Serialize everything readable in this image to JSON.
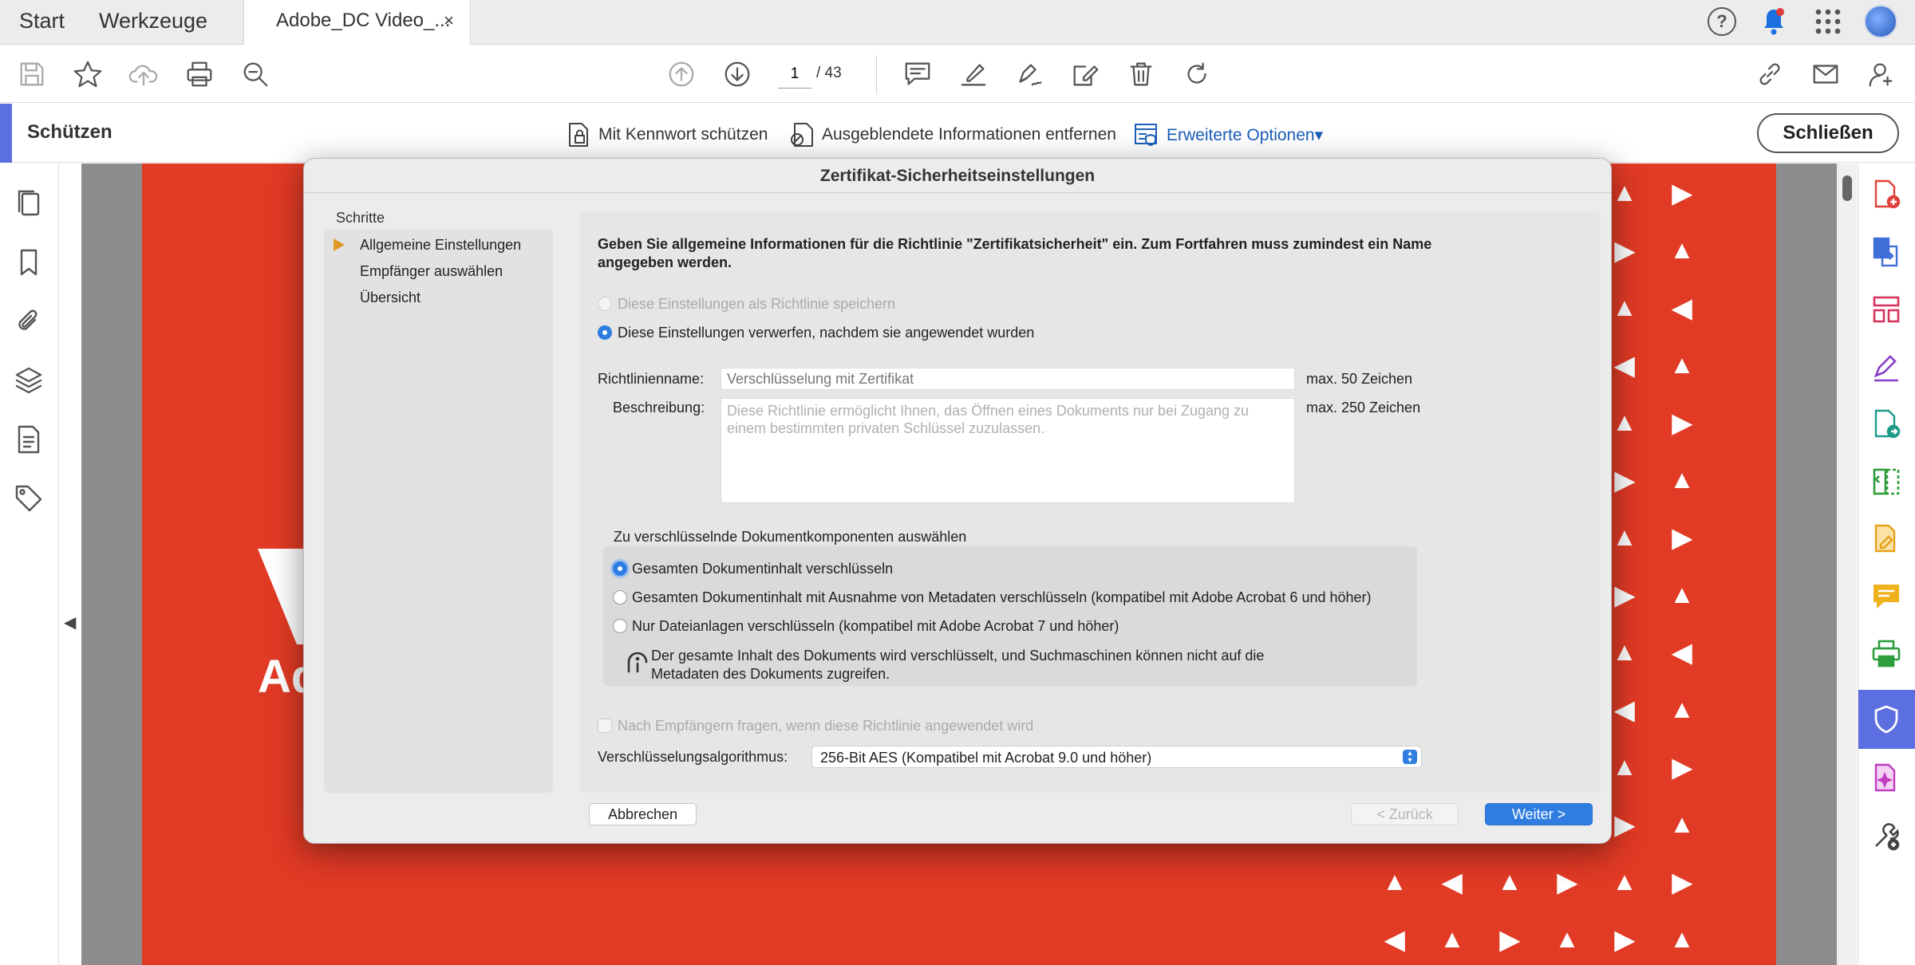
{
  "tabs": {
    "start": "Start",
    "tools": "Werkzeuge",
    "document": "Adobe_DC Video_...",
    "close_glyph": "×"
  },
  "toolbar": {
    "current_page": "1",
    "total_pages": "/ 43"
  },
  "protect_bar": {
    "title": "Schützen",
    "password_protect": "Mit Kennwort schützen",
    "remove_hidden": "Ausgeblendete Informationen entfernen",
    "advanced_options": "Erweiterte Optionen▾",
    "close_button": "Schließen"
  },
  "dialog": {
    "title": "Zertifikat-Sicherheitseinstellungen",
    "steps_heading": "Schritte",
    "steps": [
      "Allgemeine Einstellungen",
      "Empfänger auswählen",
      "Übersicht"
    ],
    "intro": "Geben Sie allgemeine Informationen für die Richtlinie \"Zertifikatsicherheit\" ein. Zum Fortfahren muss zumindest ein Name angegeben werden.",
    "save_as_policy": "Diese Einstellungen als Richtlinie speichern",
    "discard_after_apply": "Diese Einstellungen verwerfen, nachdem sie angewendet wurden",
    "policy_name_label": "Richtlinienname:",
    "policy_name_placeholder": "Verschlüsselung mit Zertifikat",
    "policy_name_limit": "max. 50 Zeichen",
    "description_label": "Beschreibung:",
    "description_placeholder": "Diese Richtlinie ermöglicht Ihnen, das Öffnen eines Dokuments nur bei Zugang zu einem bestimmten privaten Schlüssel zuzulassen.",
    "description_limit": "max. 250 Zeichen",
    "components_heading": "Zu verschlüsselnde Dokumentkomponenten auswählen",
    "components": [
      "Gesamten Dokumentinhalt verschlüsseln",
      "Gesamten Dokumentinhalt mit Ausnahme von Metadaten verschlüsseln (kompatibel mit Adobe Acrobat 6 und höher)",
      "Nur Dateianlagen verschlüsseln (kompatibel mit Adobe Acrobat 7 und höher)"
    ],
    "components_info": "Der gesamte Inhalt des Dokuments wird verschlüsselt, und Suchmaschinen können nicht auf die Metadaten des Dokuments zugreifen.",
    "ask_recipients": "Nach Empfängern fragen, wenn diese Richtlinie angewendet wird",
    "algorithm_label": "Verschlüsselungsalgorithmus:",
    "algorithm_value": "256-Bit AES (Kompatibel mit Acrobat 9.0 und höher)",
    "cancel": "Abbrechen",
    "back": "< Zurück",
    "next": "Weiter >"
  },
  "page_logo_text": "Ado",
  "colors": {
    "accent": "#5b6fe0",
    "primary_button": "#2f7de1",
    "page_red": "#e13a25",
    "step_arrow": "#e09a28"
  },
  "icons": {
    "toolbar": [
      "save-icon",
      "star-icon",
      "cloud-upload-icon",
      "print-icon",
      "zoom-search-icon",
      "page-up-icon",
      "page-down-icon",
      "comment-icon",
      "highlight-icon",
      "sign-icon",
      "edit-icon",
      "delete-icon",
      "rotate-icon",
      "link-icon",
      "email-icon",
      "share-user-icon"
    ],
    "left_nav": [
      "pages-icon",
      "bookmark-icon",
      "attachment-icon",
      "layers-icon",
      "document-icon",
      "tag-icon"
    ],
    "right_panel": [
      "create-pdf-icon",
      "export-pdf-icon",
      "organize-pages-icon",
      "fill-sign-icon",
      "convert-icon",
      "compare-icon",
      "edit-pdf-icon",
      "comment-tool-icon",
      "print-production-icon",
      "protect-icon",
      "rich-media-icon",
      "more-tools-icon"
    ]
  }
}
